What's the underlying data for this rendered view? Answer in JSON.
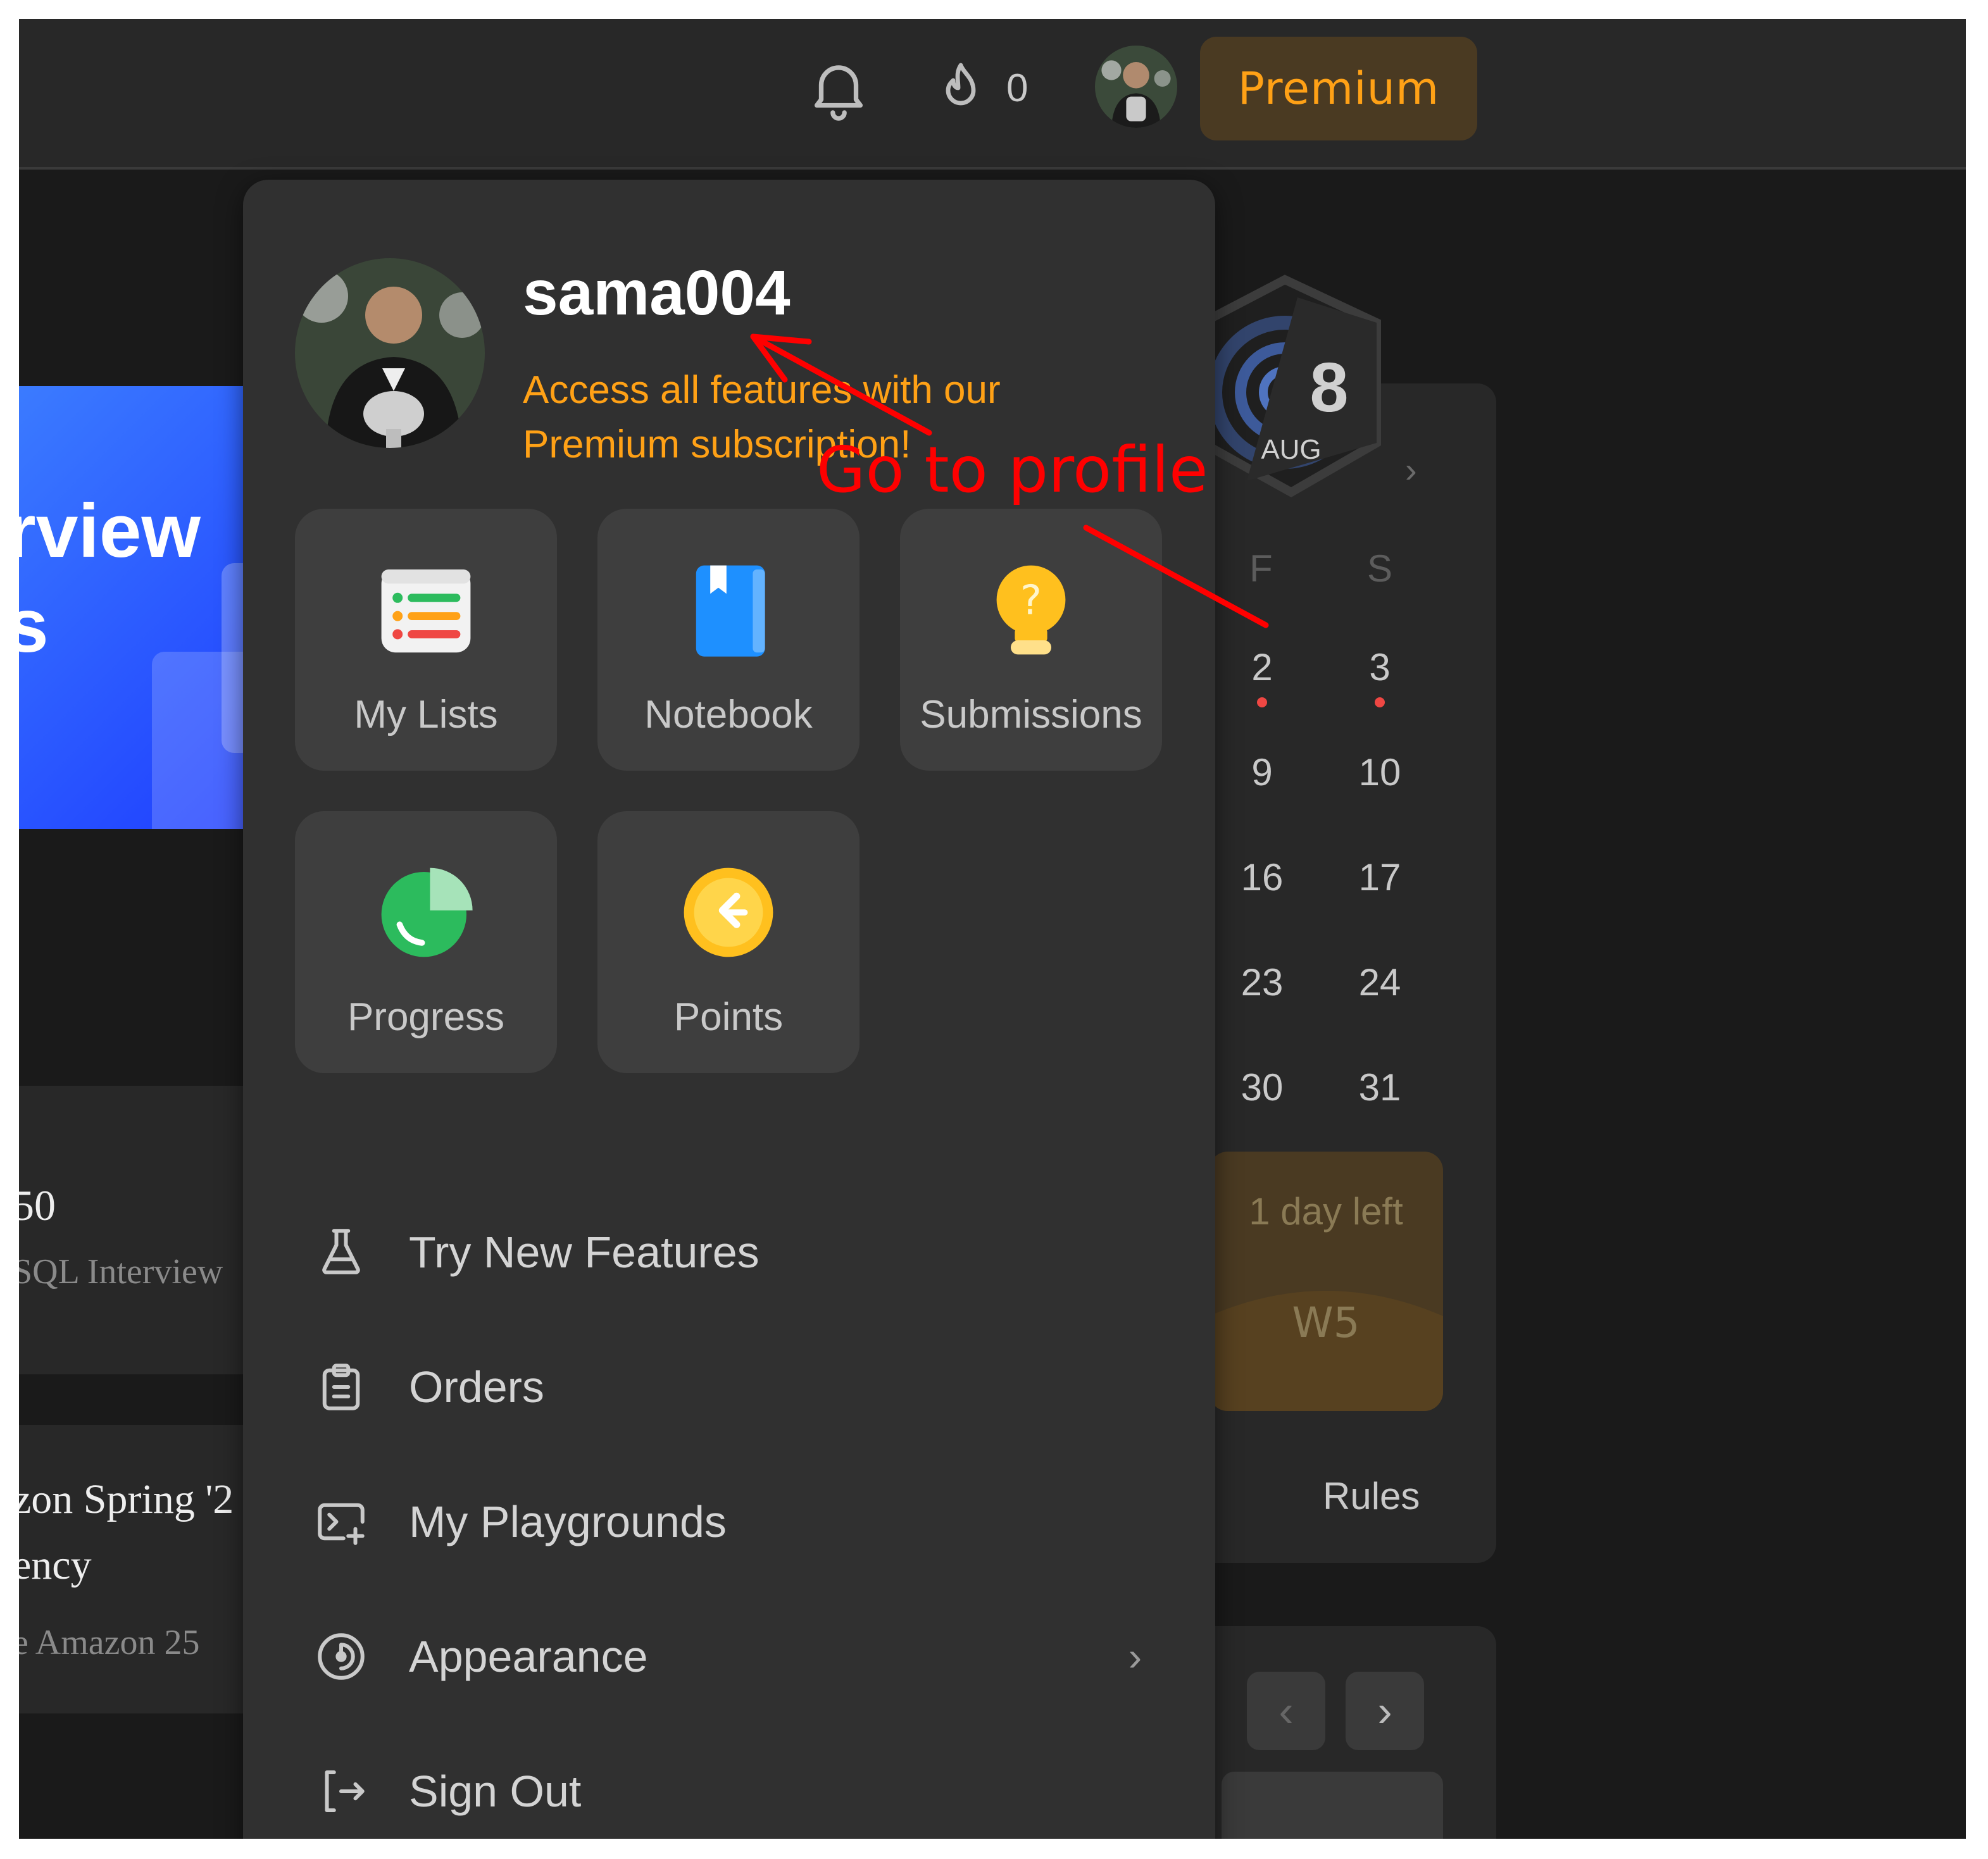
{
  "topbar": {
    "streak_count": "0",
    "premium_label": "Premium"
  },
  "background": {
    "banner_line1": "rview",
    "banner_line2": "s",
    "card1_title": "50",
    "card1_sub": "SQL Interview",
    "card2_title_line1": "zon Spring '2",
    "card2_title_line2": "ency",
    "card2_sub": "e Amazon 25"
  },
  "calendar": {
    "badge_number": "8",
    "badge_month": "AUG",
    "day_headers": [
      "F",
      "S"
    ],
    "rows": [
      [
        "2",
        "3"
      ],
      [
        "9",
        "10"
      ],
      [
        "16",
        "17"
      ],
      [
        "23",
        "24"
      ],
      [
        "30",
        "31"
      ]
    ],
    "days_left": "1 day left",
    "week_code": "W5",
    "rules_label": "Rules"
  },
  "dropdown": {
    "username": "sama004",
    "promo": "Access all features with our Premium subscription!",
    "tiles": [
      {
        "label": "My Lists",
        "icon": "list-icon"
      },
      {
        "label": "Notebook",
        "icon": "notebook-icon"
      },
      {
        "label": "Submissions",
        "icon": "lightbulb-icon"
      },
      {
        "label": "Progress",
        "icon": "pie-chart-icon"
      },
      {
        "label": "Points",
        "icon": "coin-icon"
      }
    ],
    "menu": [
      {
        "label": "Try New Features",
        "icon": "flask-icon"
      },
      {
        "label": "Orders",
        "icon": "clipboard-icon"
      },
      {
        "label": "My Playgrounds",
        "icon": "terminal-icon"
      },
      {
        "label": "Appearance",
        "icon": "appearance-icon"
      },
      {
        "label": "Sign Out",
        "icon": "sign-out-icon"
      }
    ]
  },
  "annotation": {
    "label": "Go to profile",
    "color": "#ff0000"
  },
  "colors": {
    "accent": "#ffa116",
    "premium_bg": "#4a3a22",
    "dropdown_bg": "#303030",
    "tile_bg": "#3e3e3e"
  }
}
